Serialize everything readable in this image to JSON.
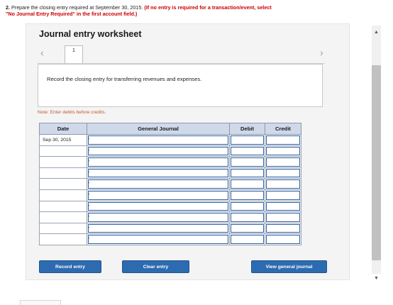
{
  "question": {
    "number": "2.",
    "text": "Prepare the closing entry required at September 30, 2015.",
    "hint": "(If no entry is required for a transaction/event, select \"No Journal Entry Required\" in the first account field.)"
  },
  "worksheet": {
    "title": "Journal entry worksheet",
    "tab_label": "1",
    "instruction": "Record the closing entry for transferring revenues and expenses.",
    "note": "Note: Enter debits before credits."
  },
  "table": {
    "headers": {
      "date": "Date",
      "account": "General Journal",
      "debit": "Debit",
      "credit": "Credit"
    },
    "rows": [
      {
        "date": "Sep 30, 2015"
      },
      {
        "date": ""
      },
      {
        "date": ""
      },
      {
        "date": ""
      },
      {
        "date": ""
      },
      {
        "date": ""
      },
      {
        "date": ""
      },
      {
        "date": ""
      },
      {
        "date": ""
      },
      {
        "date": ""
      }
    ]
  },
  "buttons": {
    "record": "Record entry",
    "clear": "Clear entry",
    "view": "View general journal"
  },
  "icons": {
    "prev": "chevron-left-icon",
    "next": "chevron-right-icon",
    "scroll_up": "triangle-up-icon",
    "scroll_down": "triangle-down-icon"
  },
  "colors": {
    "accent_button": "#2d6bb0",
    "hint_red": "#cc0000",
    "table_header": "#cfd9ea",
    "field_border": "#2b5ea0"
  }
}
